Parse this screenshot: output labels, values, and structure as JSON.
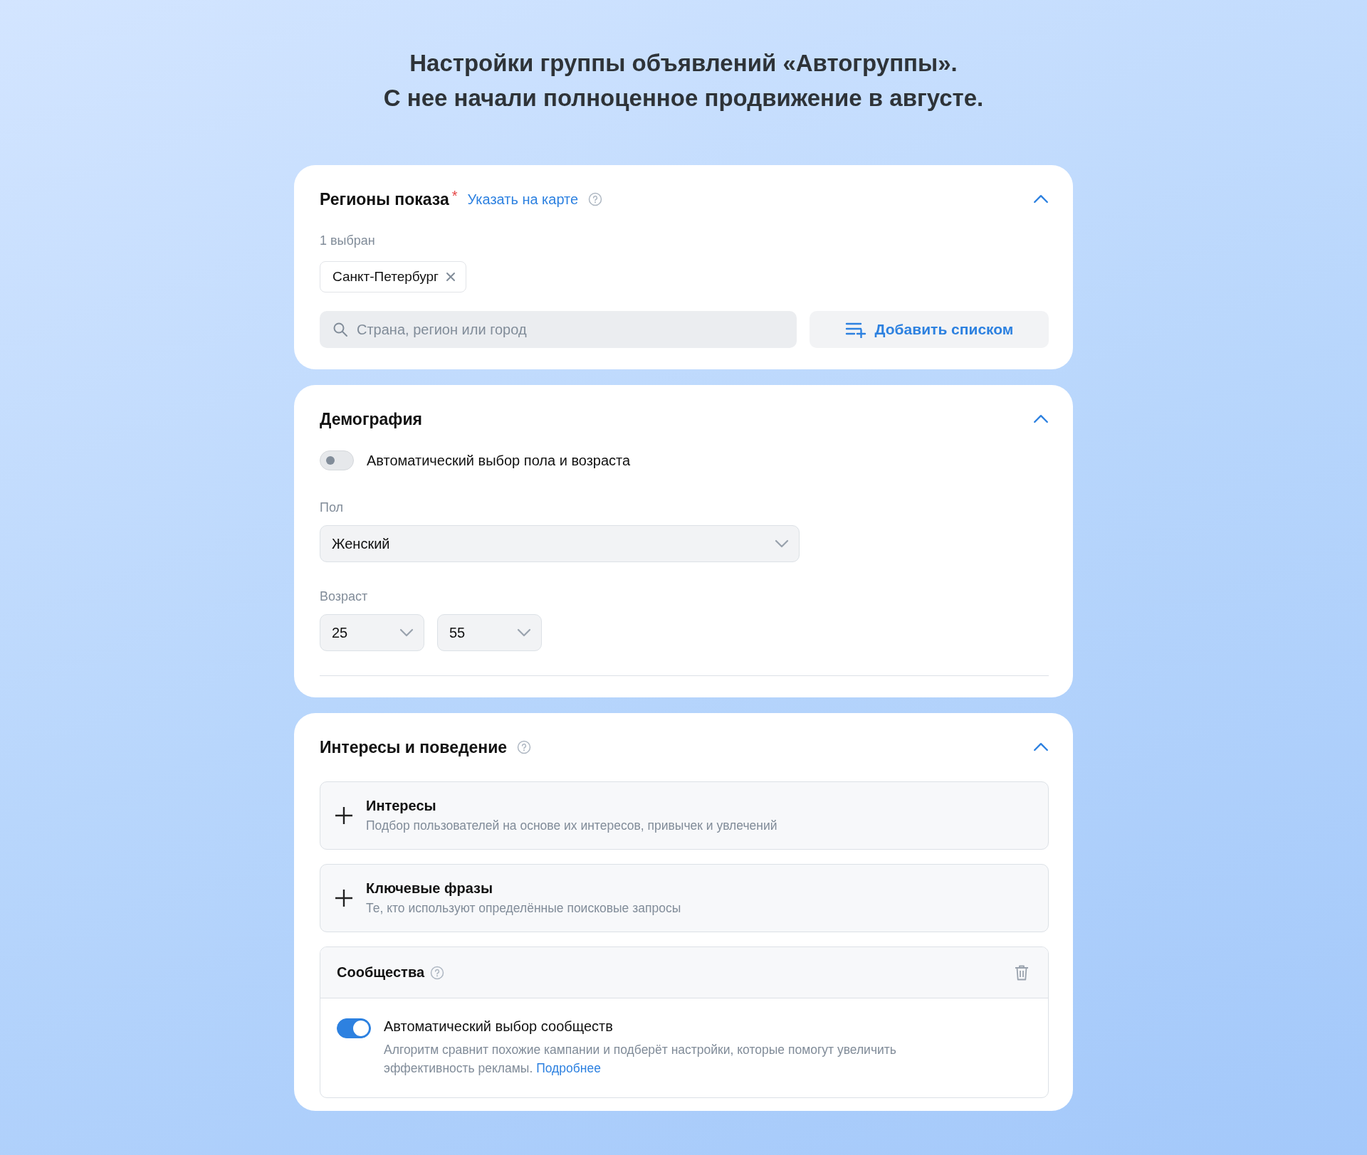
{
  "heading": [
    "Настройки группы объявлений «Автогруппы».",
    "С нее начали полноценное продвижение в августе."
  ],
  "regions": {
    "title": "Регионы показа",
    "required_mark": "*",
    "map_link": "Указать на карте",
    "expanded": true,
    "selected_count": "1 выбран",
    "chips": [
      {
        "label": "Санкт-Петербург"
      }
    ],
    "search": {
      "placeholder": "Страна, регион или город"
    },
    "add_list_button": "Добавить списком"
  },
  "demography": {
    "title": "Демография",
    "expanded": true,
    "auto_toggle": {
      "label": "Автоматический выбор пола и возраста",
      "on": false
    },
    "gender": {
      "label": "Пол",
      "value": "Женский"
    },
    "age": {
      "label": "Возраст",
      "from": "25",
      "to": "55"
    }
  },
  "interests": {
    "title": "Интересы и поведение",
    "expanded": true,
    "items": [
      {
        "kind": "add",
        "title": "Интересы",
        "description": "Подбор пользователей на основе их интересов, привычек и увлечений"
      },
      {
        "kind": "add",
        "title": "Ключевые фразы",
        "description": "Те, кто используют определённые поисковые запросы"
      },
      {
        "kind": "section",
        "title": "Сообщества",
        "toggle": {
          "label": "Автоматический выбор сообществ",
          "on": true,
          "description": "Алгоритм сравнит похожие кампании и подберёт настройки, которые помогут увеличить эффективность рекламы.",
          "link": "Подробнее"
        }
      }
    ]
  }
}
